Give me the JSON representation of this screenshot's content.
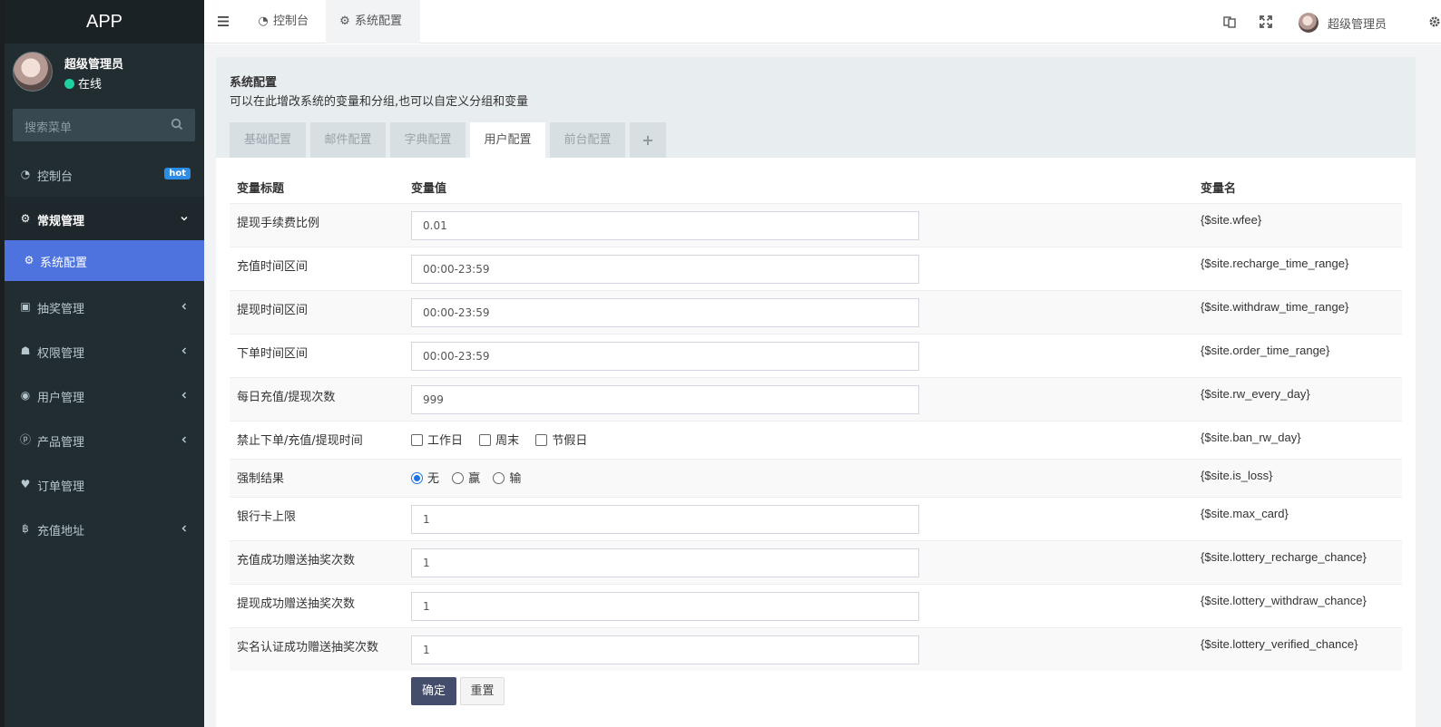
{
  "app": {
    "title": "APP"
  },
  "user": {
    "name": "超级管理员",
    "status": "在线"
  },
  "search": {
    "placeholder": "搜索菜单"
  },
  "menu": {
    "dashboard": {
      "label": "控制台",
      "badge": "hot"
    },
    "general": {
      "label": "常规管理"
    },
    "sysconfig": {
      "label": "系统配置"
    },
    "lottery": {
      "label": "抽奖管理"
    },
    "permission": {
      "label": "权限管理"
    },
    "users": {
      "label": "用户管理"
    },
    "products": {
      "label": "产品管理"
    },
    "orders": {
      "label": "订单管理"
    },
    "recharge": {
      "label": "充值地址"
    }
  },
  "topbar": {
    "tab_dashboard": "控制台",
    "tab_sysconfig": "系统配置",
    "user_name": "超级管理员"
  },
  "page": {
    "title": "系统配置",
    "description": "可以在此增改系统的变量和分组,也可以自定义分组和变量",
    "tabs": [
      "基础配置",
      "邮件配置",
      "字典配置",
      "用户配置",
      "前台配置"
    ],
    "active_tab": "用户配置",
    "add_tab": "+"
  },
  "table": {
    "headers": {
      "title": "变量标题",
      "value": "变量值",
      "name": "变量名"
    },
    "rows": [
      {
        "title": "提现手续费比例",
        "value": "0.01",
        "name": "{$site.wfee}"
      },
      {
        "title": "充值时间区间",
        "value": "00:00-23:59",
        "name": "{$site.recharge_time_range}"
      },
      {
        "title": "提现时间区间",
        "value": "00:00-23:59",
        "name": "{$site.withdraw_time_range}"
      },
      {
        "title": "下单时间区间",
        "value": "00:00-23:59",
        "name": "{$site.order_time_range}"
      },
      {
        "title": "每日充值/提现次数",
        "value": "999",
        "name": "{$site.rw_every_day}"
      },
      {
        "title": "禁止下单/充值/提现时间",
        "options": [
          "工作日",
          "周末",
          "节假日"
        ],
        "name": "{$site.ban_rw_day}"
      },
      {
        "title": "强制结果",
        "options": [
          "无",
          "赢",
          "输"
        ],
        "selected": "无",
        "name": "{$site.is_loss}"
      },
      {
        "title": "银行卡上限",
        "value": "1",
        "name": "{$site.max_card}"
      },
      {
        "title": "充值成功赠送抽奖次数",
        "value": "1",
        "name": "{$site.lottery_recharge_chance}"
      },
      {
        "title": "提现成功赠送抽奖次数",
        "value": "1",
        "name": "{$site.lottery_withdraw_chance}"
      },
      {
        "title": "实名认证成功赠送抽奖次数",
        "value": "1",
        "name": "{$site.lottery_verified_chance}"
      }
    ]
  },
  "buttons": {
    "submit": "确定",
    "reset": "重置"
  },
  "colors": {
    "sidebar": "#222d32",
    "active_menu": "#4e73df",
    "primary_button": "#444d6c",
    "online": "#1dd1a1",
    "badge": "#2d8ce6"
  }
}
